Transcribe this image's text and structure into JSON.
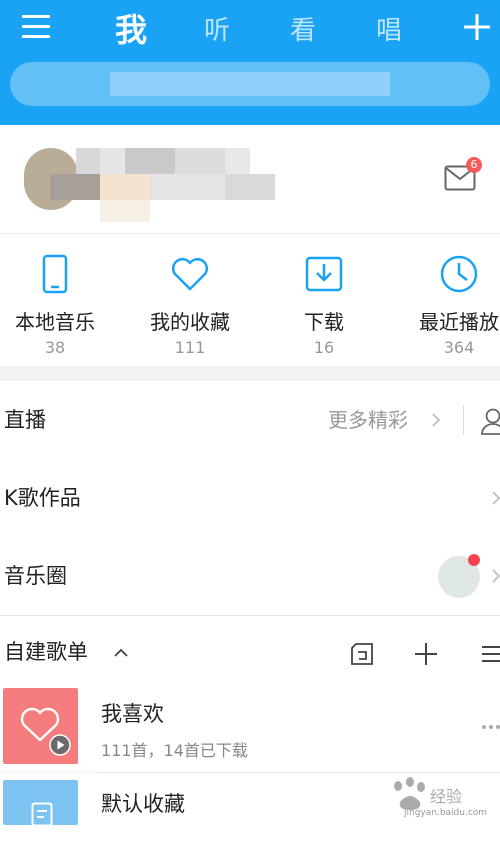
{
  "header": {
    "tabs": [
      {
        "label": "我",
        "active": true
      },
      {
        "label": "听",
        "active": false
      },
      {
        "label": "看",
        "active": false
      },
      {
        "label": "唱",
        "active": false
      }
    ],
    "accent_color": "#1aa3f5",
    "menu_icon": "menu-icon",
    "add_icon": "plus-icon"
  },
  "profile": {
    "mail_badge": "6",
    "mail_icon": "mail-icon"
  },
  "quick_access": [
    {
      "label": "本地音乐",
      "count": "38",
      "icon": "phone-icon"
    },
    {
      "label": "我的收藏",
      "count": "111",
      "icon": "heart-icon"
    },
    {
      "label": "下载",
      "count": "16",
      "icon": "download-icon"
    },
    {
      "label": "最近播放",
      "count": "364",
      "icon": "clock-icon"
    }
  ],
  "rows": {
    "live": {
      "title": "直播",
      "more": "更多精彩"
    },
    "karaoke": {
      "title": "K歌作品"
    },
    "music_circle": {
      "title": "音乐圈"
    }
  },
  "playlists_section": {
    "title": "自建歌单",
    "tools": [
      "import-icon",
      "plus-icon",
      "list-menu-icon"
    ]
  },
  "playlists": [
    {
      "title": "我喜欢",
      "subtitle": "111首，14首已下载",
      "cover_color": "#f47c7c"
    },
    {
      "title": "默认收藏",
      "cover_color": "#7cc3f2"
    }
  ],
  "watermark": {
    "url_text": "jingyan.baidu.com"
  }
}
